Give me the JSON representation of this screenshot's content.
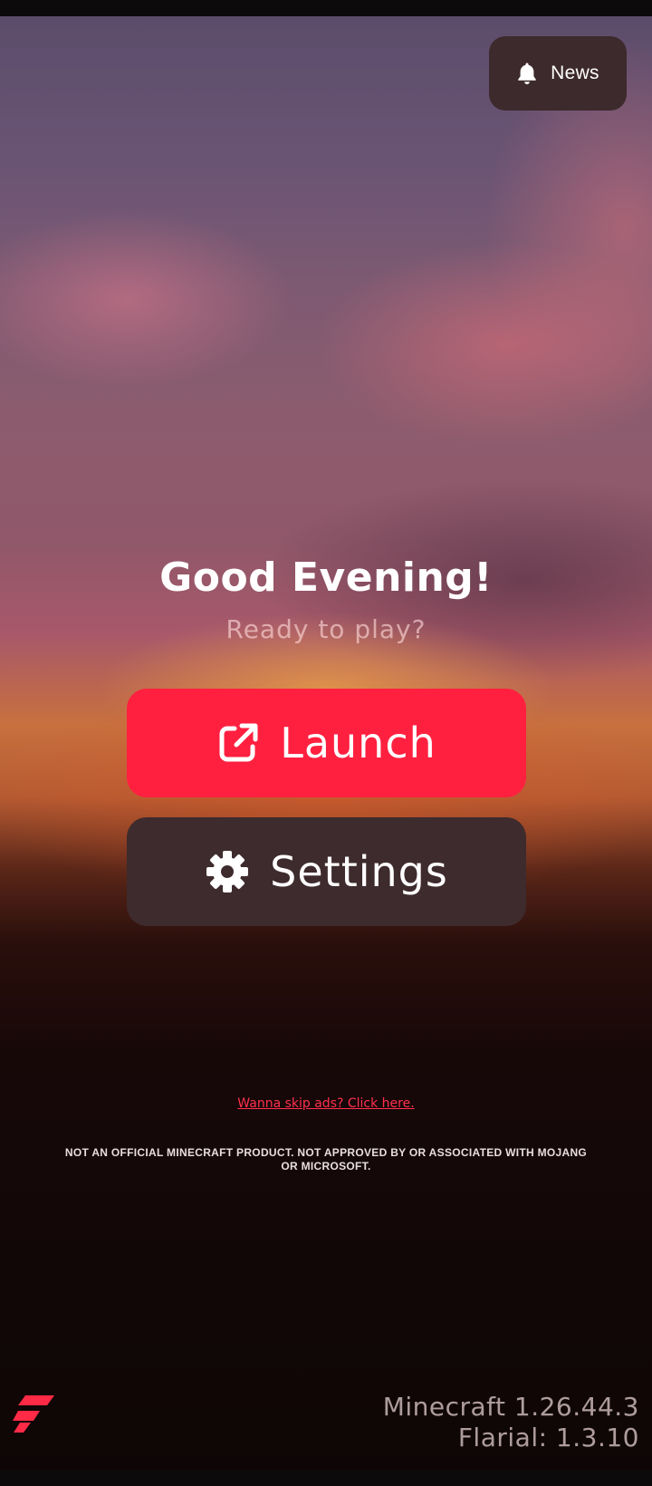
{
  "header": {
    "news_label": "News"
  },
  "main": {
    "greeting": "Good Evening!",
    "subtitle": "Ready to play?",
    "launch_label": "Launch",
    "settings_label": "Settings"
  },
  "footer": {
    "skip_ads_link": "Wanna skip ads? Click here.",
    "disclaimer": "NOT AN OFFICIAL MINECRAFT PRODUCT. NOT APPROVED BY OR ASSOCIATED WITH MOJANG OR MICROSOFT.",
    "minecraft_version": "Minecraft 1.26.44.3",
    "flarial_version": "Flarial: 1.3.10"
  },
  "icons": {
    "news": "bell-icon",
    "launch": "external-link-icon",
    "settings": "gear-icon",
    "logo": "flarial-logo-icon"
  },
  "colors": {
    "accent": "#ff2040",
    "dark_button": "#3e2b2d",
    "link": "#ff2f4e"
  }
}
